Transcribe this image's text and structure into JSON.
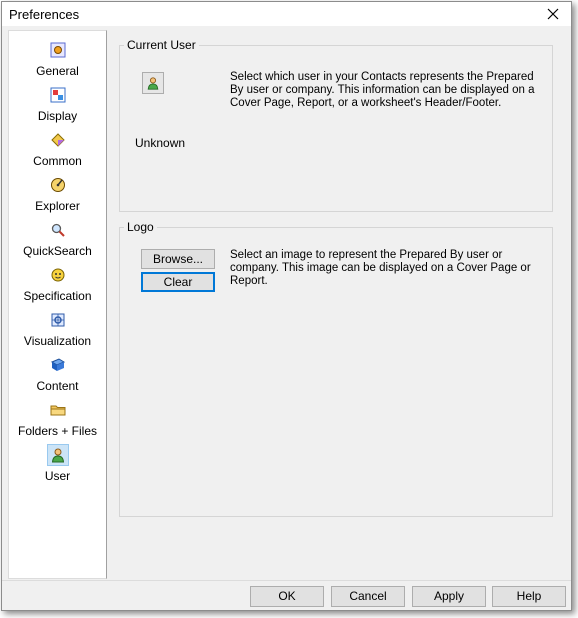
{
  "window": {
    "title": "Preferences"
  },
  "sidebar": {
    "items": [
      {
        "label": "General",
        "icon": "general-icon"
      },
      {
        "label": "Display",
        "icon": "display-icon"
      },
      {
        "label": "Common",
        "icon": "common-icon"
      },
      {
        "label": "Explorer",
        "icon": "explorer-icon"
      },
      {
        "label": "QuickSearch",
        "icon": "quicksearch-icon"
      },
      {
        "label": "Specification",
        "icon": "specification-icon"
      },
      {
        "label": "Visualization",
        "icon": "visualization-icon"
      },
      {
        "label": "Content",
        "icon": "content-icon"
      },
      {
        "label": "Folders + Files",
        "icon": "folder-icon"
      },
      {
        "label": "User",
        "icon": "user-icon",
        "selected": true
      }
    ]
  },
  "current_user": {
    "legend": "Current User",
    "description": "Select which user in your Contacts represents the Prepared By user or company.  This information can be displayed on a Cover Page, Report, or a worksheet's Header/Footer.",
    "user_name": "Unknown"
  },
  "logo": {
    "legend": "Logo",
    "browse_label": "Browse...",
    "clear_label": "Clear",
    "description": "Select an image to represent the Prepared By user or company. This image can be displayed on a Cover Page or Report."
  },
  "footer": {
    "ok_label": "OK",
    "cancel_label": "Cancel",
    "apply_label": "Apply",
    "help_label": "Help"
  },
  "colors": {
    "selection": "#cce4f7",
    "focus_border": "#0078d7",
    "background": "#f0f0f0"
  }
}
